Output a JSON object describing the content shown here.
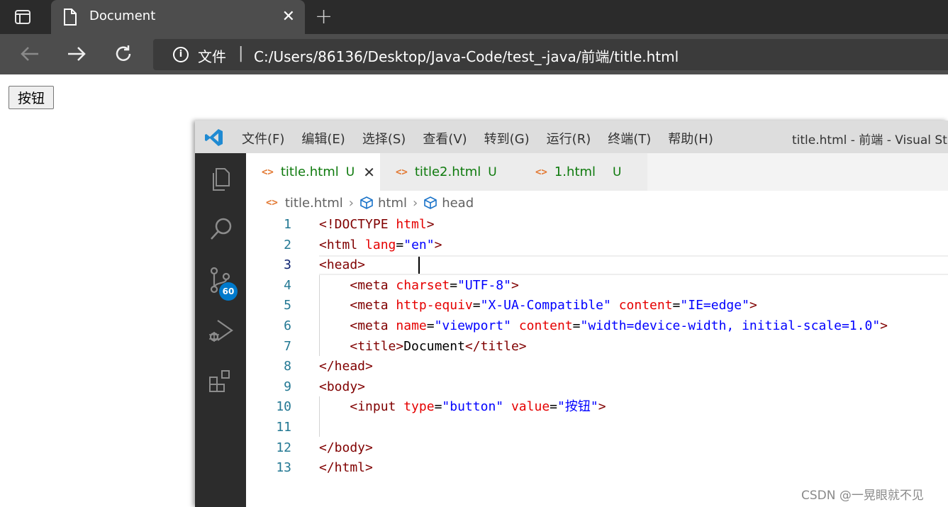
{
  "browser": {
    "tab_title": "Document",
    "tab_close": "✕",
    "new_tab": "+",
    "url_label": "文件",
    "url_separator": "|",
    "url": "C:/Users/86136/Desktop/Java-Code/test_-java/前端/title.html"
  },
  "page": {
    "button_value": "按钮"
  },
  "vscode": {
    "menu": [
      "文件(F)",
      "编辑(E)",
      "选择(S)",
      "查看(V)",
      "转到(G)",
      "运行(R)",
      "终端(T)",
      "帮助(H)"
    ],
    "window_title": "title.html - 前端 - Visual Stud",
    "source_control_badge": "60",
    "tabs": [
      {
        "name": "title.html",
        "status": "U",
        "close": "✕"
      },
      {
        "name": "title2.html",
        "status": "U"
      },
      {
        "name": "1.html",
        "status": "U"
      }
    ],
    "breadcrumb": [
      "title.html",
      "html",
      "head"
    ],
    "code_icon": "<>",
    "lines": [
      {
        "n": "1",
        "parts": [
          [
            "t-tag",
            "<!DOCTYPE "
          ],
          [
            "t-attr",
            "html"
          ],
          [
            "t-tag",
            ">"
          ]
        ]
      },
      {
        "n": "2",
        "parts": [
          [
            "t-tag",
            "<html "
          ],
          [
            "t-attr",
            "lang"
          ],
          [
            "t-txt",
            "="
          ],
          [
            "t-str",
            "\"en\""
          ],
          [
            "t-tag",
            ">"
          ]
        ]
      },
      {
        "n": "3",
        "parts": [
          [
            "t-tag",
            "<head>"
          ]
        ]
      },
      {
        "n": "4",
        "parts": [
          [
            "t-txt",
            "    "
          ],
          [
            "t-tag",
            "<meta "
          ],
          [
            "t-attr",
            "charset"
          ],
          [
            "t-txt",
            "="
          ],
          [
            "t-str",
            "\"UTF-8\""
          ],
          [
            "t-tag",
            ">"
          ]
        ]
      },
      {
        "n": "5",
        "parts": [
          [
            "t-txt",
            "    "
          ],
          [
            "t-tag",
            "<meta "
          ],
          [
            "t-attr",
            "http-equiv"
          ],
          [
            "t-txt",
            "="
          ],
          [
            "t-str",
            "\"X-UA-Compatible\""
          ],
          [
            "t-txt",
            " "
          ],
          [
            "t-attr",
            "content"
          ],
          [
            "t-txt",
            "="
          ],
          [
            "t-str",
            "\"IE=edge\""
          ],
          [
            "t-tag",
            ">"
          ]
        ]
      },
      {
        "n": "6",
        "parts": [
          [
            "t-txt",
            "    "
          ],
          [
            "t-tag",
            "<meta "
          ],
          [
            "t-attr",
            "name"
          ],
          [
            "t-txt",
            "="
          ],
          [
            "t-str",
            "\"viewport\""
          ],
          [
            "t-txt",
            " "
          ],
          [
            "t-attr",
            "content"
          ],
          [
            "t-txt",
            "="
          ],
          [
            "t-str",
            "\"width=device-width, initial-scale=1.0\""
          ],
          [
            "t-tag",
            ">"
          ]
        ]
      },
      {
        "n": "7",
        "parts": [
          [
            "t-txt",
            "    "
          ],
          [
            "t-tag",
            "<title>"
          ],
          [
            "t-txt",
            "Document"
          ],
          [
            "t-tag",
            "</title>"
          ]
        ]
      },
      {
        "n": "8",
        "parts": [
          [
            "t-tag",
            "</head>"
          ]
        ]
      },
      {
        "n": "9",
        "parts": [
          [
            "t-tag",
            "<body>"
          ]
        ]
      },
      {
        "n": "10",
        "parts": [
          [
            "t-txt",
            "    "
          ],
          [
            "t-tag",
            "<input "
          ],
          [
            "t-attr",
            "type"
          ],
          [
            "t-txt",
            "="
          ],
          [
            "t-str",
            "\"button\""
          ],
          [
            "t-txt",
            " "
          ],
          [
            "t-attr",
            "value"
          ],
          [
            "t-txt",
            "="
          ],
          [
            "t-str",
            "\"按钮\""
          ],
          [
            "t-tag",
            ">"
          ]
        ]
      },
      {
        "n": "11",
        "parts": []
      },
      {
        "n": "12",
        "parts": [
          [
            "t-tag",
            "</body>"
          ]
        ]
      },
      {
        "n": "13",
        "parts": [
          [
            "t-tag",
            "</html>"
          ]
        ]
      }
    ]
  },
  "watermark": "CSDN @一晃眼就不见"
}
